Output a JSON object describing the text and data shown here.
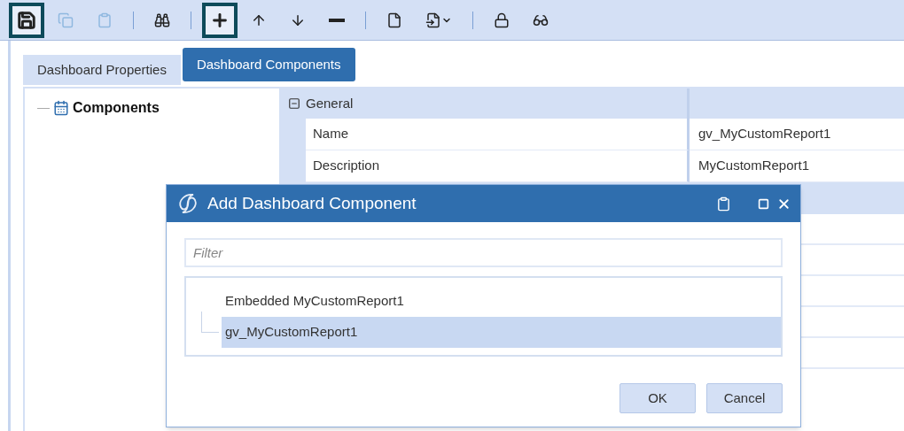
{
  "toolbar": {
    "groups": [
      [
        {
          "highlighted": true,
          "disabled": false
        },
        {
          "highlighted": false,
          "disabled": true
        },
        {
          "highlighted": false,
          "disabled": true
        }
      ],
      [
        {
          "highlighted": false,
          "disabled": false
        }
      ],
      [
        {
          "highlighted": true,
          "disabled": false
        },
        {
          "highlighted": false,
          "disabled": false
        },
        {
          "highlighted": false,
          "disabled": false
        },
        {
          "highlighted": false,
          "disabled": false
        }
      ],
      [
        {
          "highlighted": false,
          "disabled": false
        },
        {
          "highlighted": false,
          "disabled": false
        }
      ],
      [
        {
          "highlighted": false,
          "disabled": false
        },
        {
          "highlighted": false,
          "disabled": false
        }
      ]
    ]
  },
  "tabs": [
    {
      "label": "Dashboard Properties",
      "selected": false
    },
    {
      "label": "Dashboard Components",
      "selected": true
    }
  ],
  "tree": {
    "label": "Components"
  },
  "property_grid": {
    "categories": [
      {
        "label": "General",
        "expanded": true,
        "rows": [
          {
            "name": "Name",
            "value": "gv_MyCustomReport1"
          },
          {
            "name": "Description",
            "value": "MyCustomReport1"
          }
        ]
      }
    ]
  },
  "dialog": {
    "title": "Add Dashboard Component",
    "filter": {
      "placeholder": "Filter"
    },
    "items": [
      {
        "label": "Embedded MyCustomReport1",
        "selected": false,
        "children": [
          {
            "label": "gv_MyCustomReport1",
            "selected": true
          }
        ]
      }
    ],
    "buttons": [
      "OK",
      "Cancel"
    ]
  }
}
